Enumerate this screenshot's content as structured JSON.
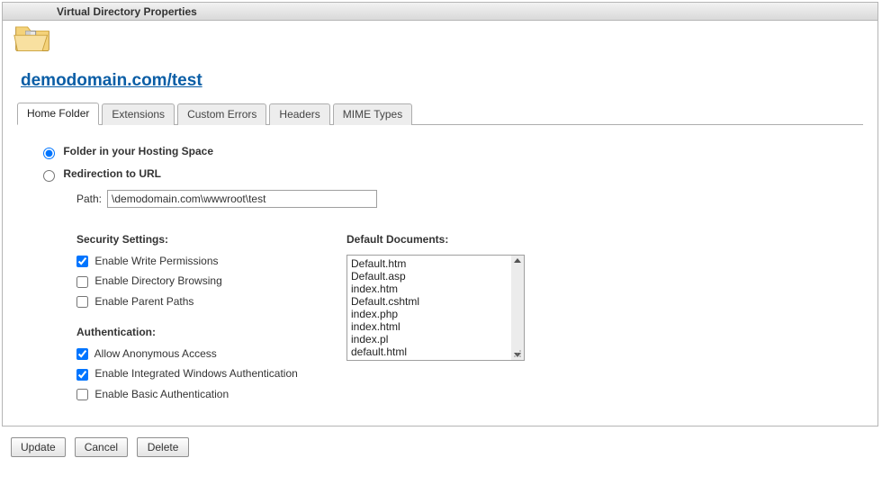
{
  "header": {
    "title": "Virtual Directory Properties"
  },
  "breadcrumb": {
    "label": "demodomain.com/test"
  },
  "tabs": [
    {
      "label": "Home Folder",
      "active": true
    },
    {
      "label": "Extensions"
    },
    {
      "label": "Custom Errors"
    },
    {
      "label": "Headers"
    },
    {
      "label": "MIME Types"
    }
  ],
  "location": {
    "folder_option": "Folder in your Hosting Space",
    "redirect_option": "Redirection to URL",
    "path_label": "Path:",
    "path_value": "\\demodomain.com\\wwwroot\\test"
  },
  "security": {
    "header": "Security Settings:",
    "write": "Enable Write Permissions",
    "browse": "Enable Directory Browsing",
    "parent": "Enable Parent Paths"
  },
  "auth": {
    "header": "Authentication:",
    "anon": "Allow Anonymous Access",
    "windows": "Enable Integrated Windows Authentication",
    "basic": "Enable Basic Authentication"
  },
  "docs": {
    "header": "Default Documents:",
    "items": [
      "Default.htm",
      "Default.asp",
      "index.htm",
      "Default.cshtml",
      "index.php",
      "index.html",
      "index.pl",
      "default.html"
    ]
  },
  "buttons": {
    "update": "Update",
    "cancel": "Cancel",
    "delete": "Delete"
  }
}
